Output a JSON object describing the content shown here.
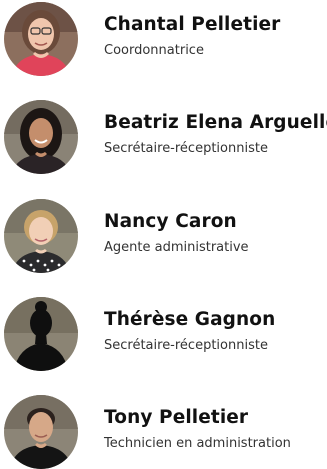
{
  "staff": [
    {
      "name": "Chantal Pelletier",
      "role": "Coordonnatrice",
      "photo_icon": "woman-photo-icon"
    },
    {
      "name": "Beatriz Elena Arguello",
      "role": "Secrétaire-réceptionniste",
      "photo_icon": "woman-photo-icon"
    },
    {
      "name": "Nancy Caron",
      "role": "Agente administrative",
      "photo_icon": "woman-photo-icon"
    },
    {
      "name": "Thérèse Gagnon",
      "role": "Secrétaire-réceptionniste",
      "photo_icon": "silhouette-placeholder-icon"
    },
    {
      "name": "Tony Pelletier",
      "role": "Technicien en administration",
      "photo_icon": "man-photo-icon"
    }
  ]
}
